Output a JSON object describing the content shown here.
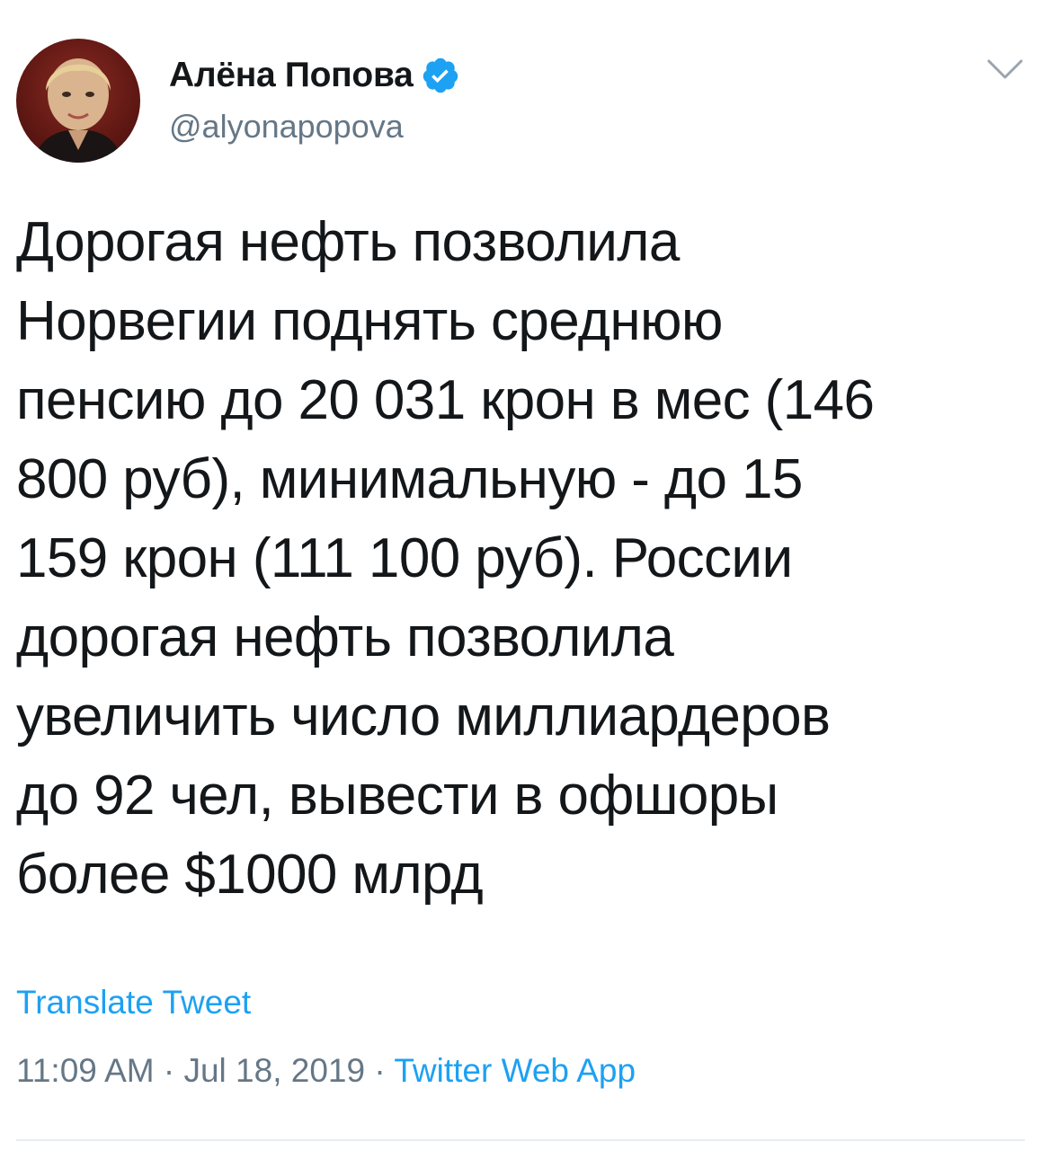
{
  "tweet": {
    "author": {
      "display_name": "Алёна Попова",
      "handle": "@alyonapopova",
      "verified": true,
      "avatar_icon": "profile-photo"
    },
    "menu_icon": "chevron-down-icon",
    "text_lines": [
      "Дорогая нефть позволила",
      "Норвегии поднять среднюю",
      "пенсию до 20 031 крон в мес (146",
      "800 руб), минимальную - до 15",
      "159 крон (111 100 руб). России",
      "дорогая нефть позволила",
      "увеличить число миллиардеров",
      "до 92 чел, вывести в офшоры",
      "более $1000 млрд"
    ],
    "translate_label": "Translate Tweet",
    "time": "11:09 AM",
    "separator": "·",
    "date": "Jul 18, 2019",
    "source": "Twitter Web App"
  },
  "colors": {
    "text": "#14171a",
    "secondary": "#657786",
    "accent": "#1da1f2",
    "divider": "#e6ecf0"
  }
}
